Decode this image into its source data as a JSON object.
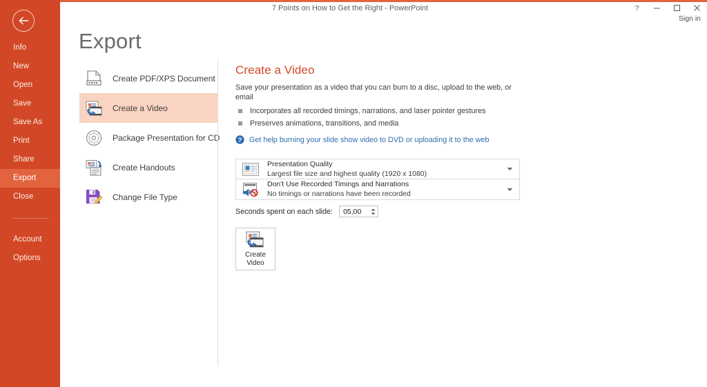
{
  "window": {
    "title": "7 Points on How to Get the Right - PowerPoint",
    "sign_in": "Sign in",
    "controls": {
      "help": "help-icon",
      "minimize": "minimize-icon",
      "maximize": "maximize-icon",
      "close": "close-icon"
    }
  },
  "colors": {
    "backstage_orange": "#d24726",
    "active_nav": "#e2643f",
    "selected_option": "#fad4c2",
    "accent_heading": "#d24726",
    "link_blue": "#2f6fad"
  },
  "sidebar": {
    "back_label": "back-arrow-icon",
    "items": [
      {
        "label": "Info",
        "active": false
      },
      {
        "label": "New",
        "active": false
      },
      {
        "label": "Open",
        "active": false
      },
      {
        "label": "Save",
        "active": false
      },
      {
        "label": "Save As",
        "active": false
      },
      {
        "label": "Print",
        "active": false
      },
      {
        "label": "Share",
        "active": false
      },
      {
        "label": "Export",
        "active": true
      },
      {
        "label": "Close",
        "active": false
      }
    ],
    "footer_items": [
      {
        "label": "Account"
      },
      {
        "label": "Options"
      }
    ]
  },
  "page": {
    "title": "Export"
  },
  "export_options": [
    {
      "label": "Create PDF/XPS Document",
      "icon": "pdf-document-icon",
      "selected": false
    },
    {
      "label": "Create a Video",
      "icon": "video-icon",
      "selected": true
    },
    {
      "label": "Package Presentation for CD",
      "icon": "cd-disc-icon",
      "selected": false
    },
    {
      "label": "Create Handouts",
      "icon": "handouts-icon",
      "selected": false
    },
    {
      "label": "Change File Type",
      "icon": "file-type-icon",
      "selected": false
    }
  ],
  "detail": {
    "title": "Create a Video",
    "description": "Save your presentation as a video that you can burn to a disc, upload to the web, or email",
    "bullets": [
      "Incorporates all recorded timings, narrations, and laser pointer gestures",
      "Preserves animations, transitions, and media"
    ],
    "help_link": "Get help burning your slide show video to DVD or uploading it to the web",
    "help_icon": "question-circle-icon",
    "quality": {
      "icon": "presentation-quality-icon",
      "title": "Presentation Quality",
      "subtitle": "Largest file size and highest quality (1920 x 1080)",
      "arrow": "chevron-down-icon"
    },
    "timings": {
      "icon": "no-narration-icon",
      "title": "Don't Use Recorded Timings and Narrations",
      "subtitle": "No timings or narrations have been recorded",
      "arrow": "chevron-down-icon"
    },
    "seconds": {
      "label": "Seconds spent on each slide:",
      "value": "05,00"
    },
    "create_button": {
      "line1": "Create",
      "line2": "Video",
      "icon": "video-icon"
    }
  }
}
